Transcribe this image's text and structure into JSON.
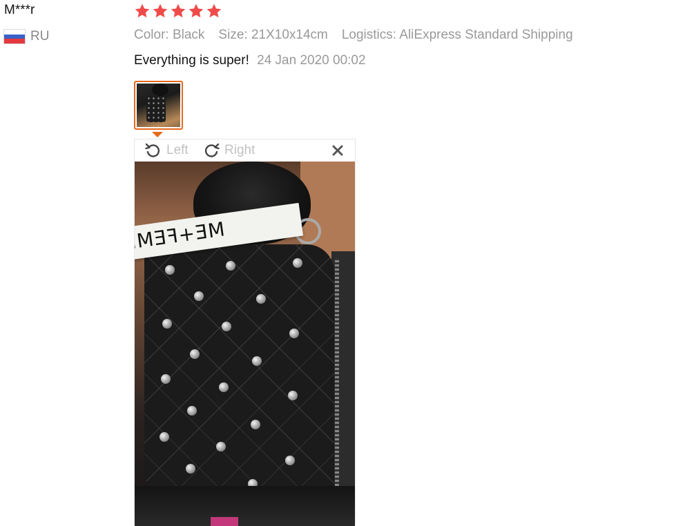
{
  "reviewer": {
    "name": "M***r",
    "country_code": "RU",
    "flag_icon": "russia-flag-icon"
  },
  "rating": {
    "stars": 5,
    "max": 5,
    "star_color": "#f04b4b"
  },
  "attributes": {
    "color": "Color: Black",
    "size": "Size: 21X10x14cm",
    "logistics": "Logistics: AliExpress Standard Shipping"
  },
  "review": {
    "text": "Everything is super!",
    "date": "24 Jan 2020 00:02"
  },
  "photo_viewer": {
    "rotate_left_label": "Left",
    "rotate_right_label": "Right",
    "rotate_left_icon": "rotate-left-icon",
    "rotate_right_icon": "rotate-right-icon",
    "close_icon": "close-icon",
    "strap_text": "ME+FEMI",
    "thumbnail_border_color": "#e5691d"
  }
}
